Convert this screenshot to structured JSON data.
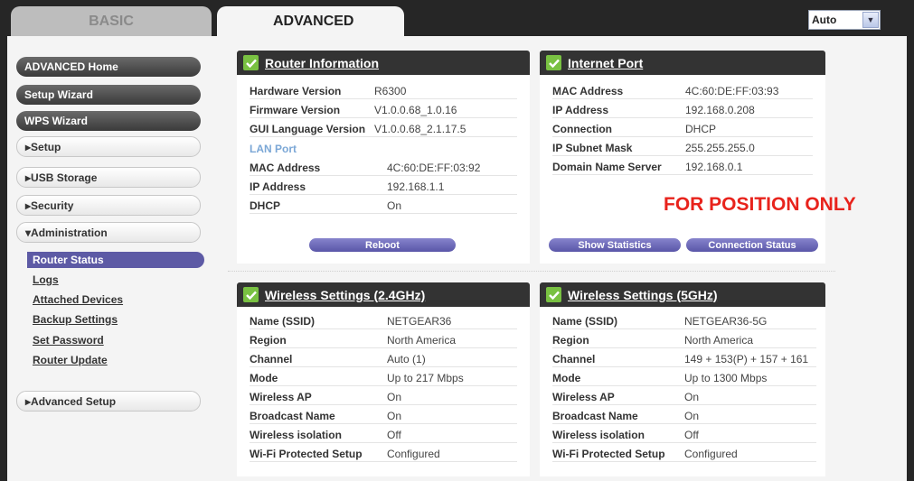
{
  "tabs": {
    "basic": "BASIC",
    "advanced": "ADVANCED"
  },
  "language_select": {
    "value": "Auto"
  },
  "sidebar": {
    "advanced_home": "ADVANCED Home",
    "setup_wizard": "Setup Wizard",
    "wps_wizard": "WPS Wizard",
    "setup": "▸Setup",
    "usb_storage": "▸USB Storage",
    "security": "▸Security",
    "administration": "▾Administration",
    "admin_items": [
      "Router Status",
      "Logs",
      "Attached Devices",
      "Backup Settings",
      "Set Password",
      "Router Update"
    ],
    "advanced_setup": "▸Advanced Setup"
  },
  "router_info": {
    "title": "Router Information",
    "rows": [
      {
        "label": "Hardware Version",
        "value": "R6300"
      },
      {
        "label": "Firmware Version",
        "value": "V1.0.0.68_1.0.16"
      },
      {
        "label": "GUI Language Version",
        "value": "V1.0.0.68_2.1.17.5"
      }
    ],
    "lan_port_label": "LAN Port",
    "lan_rows": [
      {
        "label": "MAC Address",
        "value": "4C:60:DE:FF:03:92"
      },
      {
        "label": "IP Address",
        "value": "192.168.1.1"
      },
      {
        "label": "DHCP",
        "value": "On"
      }
    ],
    "reboot_button": "Reboot"
  },
  "internet_port": {
    "title": "Internet Port",
    "rows": [
      {
        "label": "MAC Address",
        "value": "4C:60:DE:FF:03:93"
      },
      {
        "label": "IP Address",
        "value": "192.168.0.208"
      },
      {
        "label": "Connection",
        "value": "DHCP"
      },
      {
        "label": "IP Subnet Mask",
        "value": "255.255.255.0"
      },
      {
        "label": "Domain Name Server",
        "value": "192.168.0.1"
      }
    ],
    "show_statistics_button": "Show Statistics",
    "connection_status_button": "Connection Status"
  },
  "overlay_text": "FOR POSITION ONLY",
  "wireless_24": {
    "title": "Wireless Settings (2.4GHz)",
    "rows": [
      {
        "label": "Name (SSID)",
        "value": "NETGEAR36"
      },
      {
        "label": "Region",
        "value": "North America"
      },
      {
        "label": "Channel",
        "value": "Auto (1)"
      },
      {
        "label": "Mode",
        "value": "Up to 217 Mbps"
      },
      {
        "label": "Wireless AP",
        "value": "On"
      },
      {
        "label": "Broadcast Name",
        "value": "On"
      },
      {
        "label": "Wireless isolation",
        "value": "Off"
      },
      {
        "label": "Wi-Fi Protected Setup",
        "value": "Configured"
      }
    ]
  },
  "wireless_5": {
    "title": "Wireless Settings (5GHz)",
    "rows": [
      {
        "label": "Name (SSID)",
        "value": "NETGEAR36-5G"
      },
      {
        "label": "Region",
        "value": "North America"
      },
      {
        "label": "Channel",
        "value": "149 + 153(P) + 157 + 161"
      },
      {
        "label": "Mode",
        "value": "Up to 1300 Mbps"
      },
      {
        "label": "Wireless AP",
        "value": "On"
      },
      {
        "label": "Broadcast Name",
        "value": "On"
      },
      {
        "label": "Wireless isolation",
        "value": "Off"
      },
      {
        "label": "Wi-Fi Protected Setup",
        "value": "Configured"
      }
    ]
  }
}
